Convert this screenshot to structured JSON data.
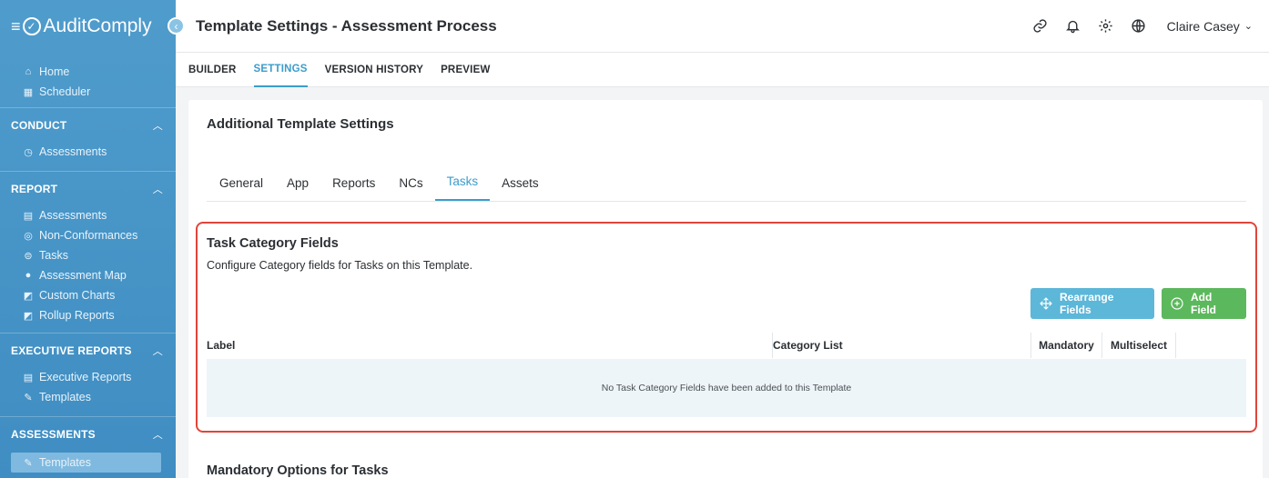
{
  "app": {
    "name": "AuditComply"
  },
  "sidebar": {
    "top_items": [
      {
        "label": "Home",
        "icon": "home-icon"
      },
      {
        "label": "Scheduler",
        "icon": "calendar-icon"
      }
    ],
    "sections": [
      {
        "title": "CONDUCT",
        "items": [
          {
            "label": "Assessments",
            "icon": "clock-icon"
          }
        ]
      },
      {
        "title": "REPORT",
        "items": [
          {
            "label": "Assessments",
            "icon": "report-icon"
          },
          {
            "label": "Non-Conformances",
            "icon": "search-icon"
          },
          {
            "label": "Tasks",
            "icon": "list-icon"
          },
          {
            "label": "Assessment Map",
            "icon": "map-pin-icon"
          },
          {
            "label": "Custom Charts",
            "icon": "chart-icon"
          },
          {
            "label": "Rollup Reports",
            "icon": "chart-icon"
          }
        ]
      },
      {
        "title": "EXECUTIVE REPORTS",
        "items": [
          {
            "label": "Executive Reports",
            "icon": "report-icon"
          },
          {
            "label": "Templates",
            "icon": "edit-icon"
          }
        ]
      },
      {
        "title": "ASSESSMENTS",
        "items": [
          {
            "label": "Templates",
            "icon": "edit-icon"
          }
        ]
      }
    ]
  },
  "header": {
    "title": "Template Settings - Assessment Process",
    "user": "Claire Casey"
  },
  "subtabs": [
    "BUILDER",
    "SETTINGS",
    "VERSION HISTORY",
    "PREVIEW"
  ],
  "card": {
    "title": "Additional Template Settings",
    "tabs": [
      "General",
      "App",
      "Reports",
      "NCs",
      "Tasks",
      "Assets"
    ],
    "section": {
      "title": "Task Category Fields",
      "subtitle": "Configure Category fields for Tasks on this Template.",
      "rearrange_label": "Rearrange Fields",
      "add_label": "Add Field",
      "columns": [
        "Label",
        "Category List",
        "Mandatory",
        "Multiselect"
      ],
      "empty_message": "No Task Category Fields have been added to this Template"
    },
    "next_section_title": "Mandatory Options for Tasks"
  },
  "colors": {
    "accent": "#3c9ccb",
    "sidebar": "#4a97c9",
    "add_button": "#5cb85c",
    "rearrange_button": "#5cb7d9",
    "highlight": "#e0453a"
  }
}
